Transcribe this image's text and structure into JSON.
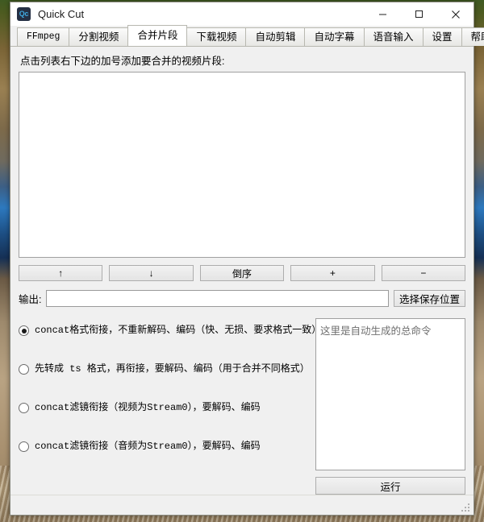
{
  "window": {
    "title": "Quick Cut",
    "icon_label": "Qc",
    "icon_name": "app-icon",
    "controls": {
      "minimize": "minimize-icon",
      "maximize": "maximize-icon",
      "close": "close-icon"
    }
  },
  "tabs": [
    {
      "label": "FFmpeg",
      "active": false,
      "mono": true
    },
    {
      "label": "分割视频",
      "active": false,
      "mono": false
    },
    {
      "label": "合并片段",
      "active": true,
      "mono": false
    },
    {
      "label": "下载视频",
      "active": false,
      "mono": false
    },
    {
      "label": "自动剪辑",
      "active": false,
      "mono": false
    },
    {
      "label": "自动字幕",
      "active": false,
      "mono": false
    },
    {
      "label": "语音输入",
      "active": false,
      "mono": false
    },
    {
      "label": "设置",
      "active": false,
      "mono": false
    },
    {
      "label": "帮助",
      "active": false,
      "mono": false
    }
  ],
  "main": {
    "hint": "点击列表右下边的加号添加要合并的视频片段:",
    "file_list_items": [],
    "list_buttons": [
      {
        "label": "↑",
        "name": "move-up-button"
      },
      {
        "label": "↓",
        "name": "move-down-button"
      },
      {
        "label": "倒序",
        "name": "reverse-order-button"
      },
      {
        "label": "+",
        "name": "add-file-button"
      },
      {
        "label": "−",
        "name": "remove-file-button"
      }
    ],
    "output": {
      "label": "输出:",
      "value": "",
      "placeholder": "",
      "browse_label": "选择保存位置"
    },
    "options": [
      {
        "label": "concat格式衔接，不重新解码、编码（快、无损、要求格式一致）",
        "checked": true
      },
      {
        "label": "先转成 ts 格式，再衔接，要解码、编码（用于合并不同格式）",
        "checked": false
      },
      {
        "label": "concat滤镜衔接（视频为Stream0），要解码、编码",
        "checked": false
      },
      {
        "label": "concat滤镜衔接（音频为Stream0），要解码、编码",
        "checked": false
      }
    ],
    "command": {
      "value": "",
      "placeholder": "这里是自动生成的总命令"
    },
    "run_label": "运行"
  },
  "colors": {
    "window_bg": "#f0f0f0",
    "titlebar_bg": "#ffffff",
    "field_bg": "#ffffff",
    "border": "#a0a0a0",
    "accent_icon": "#3fa9e0",
    "icon_bg": "#253044"
  }
}
